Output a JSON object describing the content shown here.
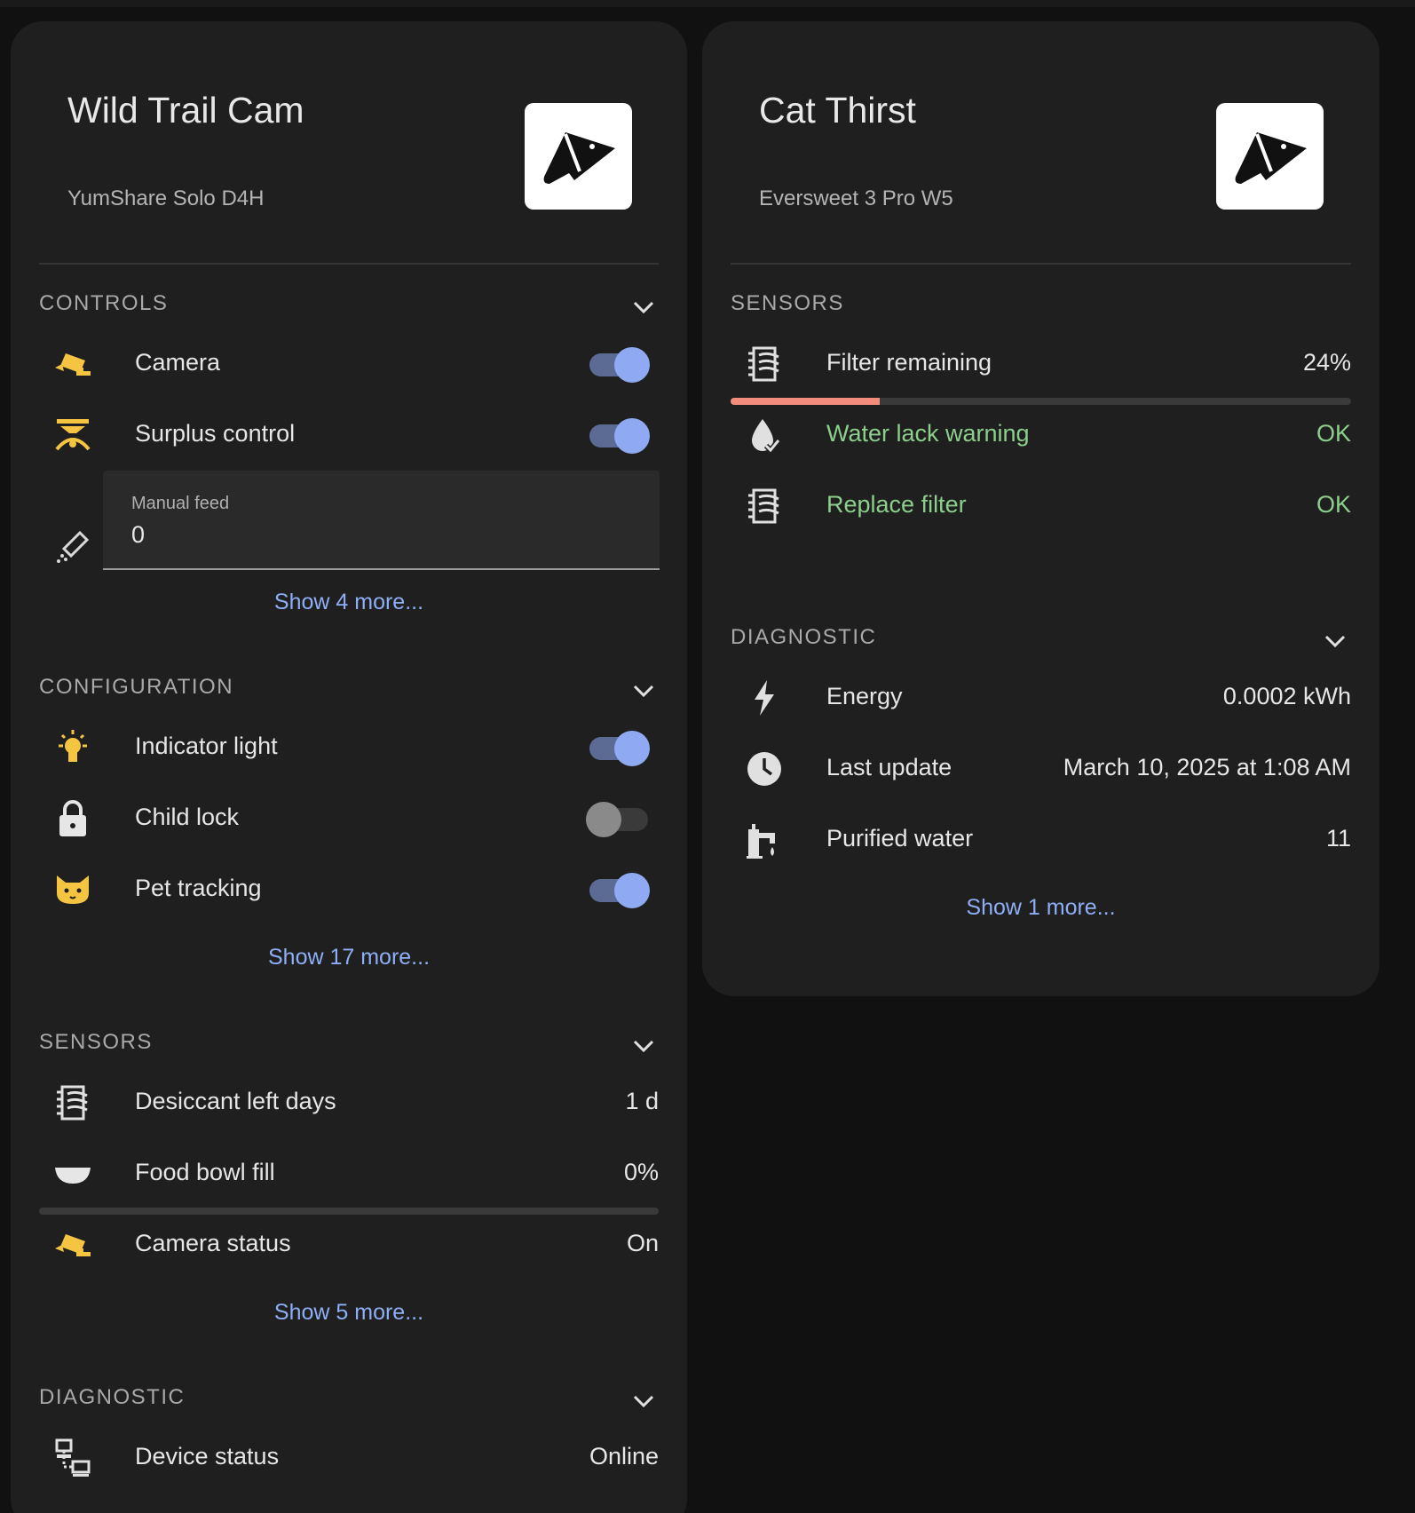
{
  "left_card": {
    "title": "Wild Trail Cam",
    "subtitle": "YumShare Solo D4H",
    "logo_icon": "petlibro-logo-icon",
    "controls": {
      "heading": "CONTROLS",
      "items": [
        {
          "label": "Camera",
          "icon": "cctv-icon",
          "state": "on"
        },
        {
          "label": "Surplus control",
          "icon": "feeder-icon",
          "state": "on"
        }
      ],
      "manual_feed": {
        "label": "Manual feed",
        "value": "0",
        "icon": "eyedropper-icon"
      },
      "more": "Show 4 more..."
    },
    "configuration": {
      "heading": "CONFIGURATION",
      "items": [
        {
          "label": "Indicator light",
          "icon": "lightbulb-on-icon",
          "state": "on"
        },
        {
          "label": "Child lock",
          "icon": "lock-icon",
          "state": "off"
        },
        {
          "label": "Pet tracking",
          "icon": "cat-icon",
          "state": "on"
        }
      ],
      "more": "Show 17 more..."
    },
    "sensors": {
      "heading": "SENSORS",
      "items": [
        {
          "label": "Desiccant left days",
          "value": "1 d",
          "icon": "filter-icon"
        },
        {
          "label": "Food bowl fill",
          "value": "0%",
          "icon": "bowl-icon",
          "level": 0
        },
        {
          "label": "Camera status",
          "value": "On",
          "icon": "cctv-icon"
        }
      ],
      "more": "Show 5 more..."
    },
    "diagnostic": {
      "heading": "DIAGNOSTIC",
      "items": [
        {
          "label": "Device status",
          "value": "Online",
          "icon": "lan-icon"
        }
      ]
    }
  },
  "right_card": {
    "title": "Cat Thirst",
    "subtitle": "Eversweet 3 Pro W5",
    "logo_icon": "petlibro-logo-icon",
    "sensors": {
      "heading": "SENSORS",
      "items": [
        {
          "label": "Filter remaining",
          "value": "24%",
          "icon": "filter-icon",
          "level": 24
        },
        {
          "label": "Water lack warning",
          "value": "OK",
          "icon": "water-check-icon"
        },
        {
          "label": "Replace filter",
          "value": "OK",
          "icon": "filter-icon"
        }
      ]
    },
    "diagnostic": {
      "heading": "DIAGNOSTIC",
      "items": [
        {
          "label": "Energy",
          "value": "0.0002 kWh",
          "icon": "lightning-icon"
        },
        {
          "label": "Last update",
          "value": "March 10, 2025 at 1:08 AM",
          "icon": "clock-icon"
        },
        {
          "label": "Purified water",
          "value": "11",
          "icon": "water-pump-icon"
        }
      ],
      "more": "Show 1 more..."
    }
  },
  "colors": {
    "background": "#111111",
    "card": "#1f1f1f",
    "accent_icon": "#f5c542",
    "toggle_on": "#8faaf2",
    "link": "#8eaff5",
    "ok": "#8ccf8c",
    "progress": "#f28c7c"
  }
}
